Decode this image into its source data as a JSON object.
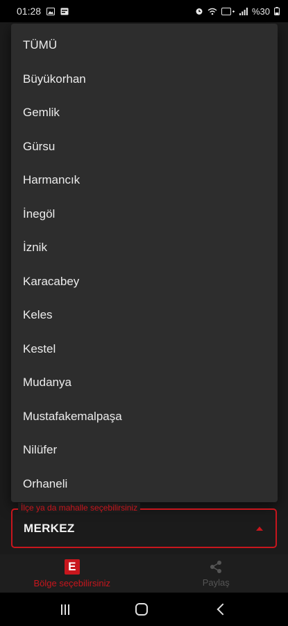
{
  "status_bar": {
    "time": "01:28",
    "battery": "%30"
  },
  "menu": {
    "items": [
      "TÜMÜ",
      "Büyükorhan",
      "Gemlik",
      "Gürsu",
      "Harmancık",
      "İnegöl",
      "İznik",
      "Karacabey",
      "Keles",
      "Kestel",
      "Mudanya",
      "Mustafakemalpaşa",
      "Nilüfer",
      "Orhaneli"
    ]
  },
  "select": {
    "label": "İlçe ya da mahalle seçebilirsiniz",
    "value": "MERKEZ"
  },
  "bottom_nav": {
    "region_label": "Bölge seçebilirsiniz",
    "region_icon_letter": "E",
    "share_label": "Paylaş"
  },
  "colors": {
    "accent": "#c8161d",
    "menu_bg": "#2d2d2d"
  }
}
